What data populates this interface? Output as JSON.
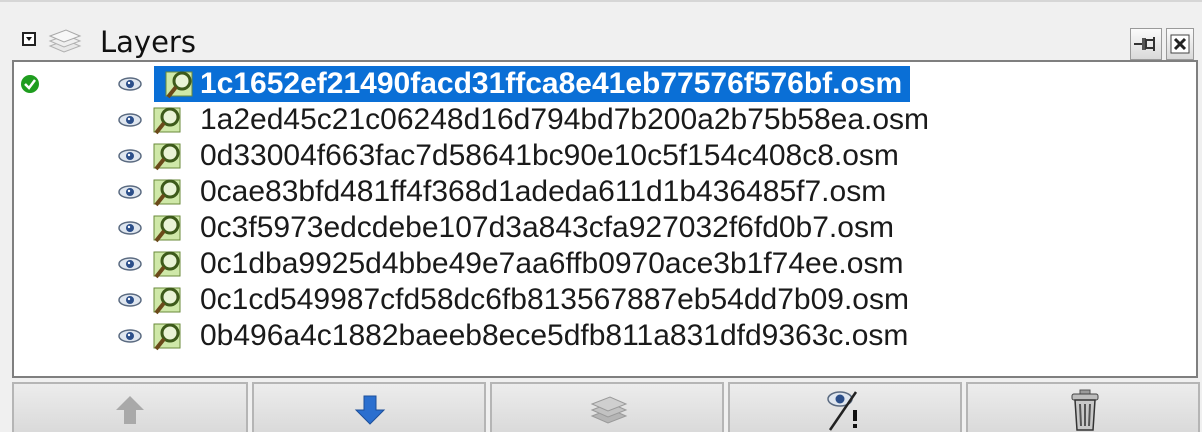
{
  "panel": {
    "title": "Layers"
  },
  "layers": [
    {
      "name": "1c1652ef21490facd31ffca8e41eb77576f576bf.osm",
      "selected": true,
      "active": true
    },
    {
      "name": "1a2ed45c21c06248d16d794bd7b200a2b75b58ea.osm",
      "selected": false,
      "active": false
    },
    {
      "name": "0d33004f663fac7d58641bc90e10c5f154c408c8.osm",
      "selected": false,
      "active": false
    },
    {
      "name": "0cae83bfd481ff4f368d1adeda611d1b436485f7.osm",
      "selected": false,
      "active": false
    },
    {
      "name": "0c3f5973edcdebe107d3a843cfa927032f6fd0b7.osm",
      "selected": false,
      "active": false
    },
    {
      "name": "0c1dba9925d4bbe49e7aa6ffb0970ace3b1f74ee.osm",
      "selected": false,
      "active": false
    },
    {
      "name": "0c1cd549987cfd58dc6fb813567887eb54dd7b09.osm",
      "selected": false,
      "active": false
    },
    {
      "name": "0b496a4c1882baeeb8ece5dfb811a831dfd9363c.osm",
      "selected": false,
      "active": false
    }
  ],
  "toolbar": {
    "buttons": [
      {
        "icon": "move-up-icon",
        "enabled": false
      },
      {
        "icon": "move-down-icon",
        "enabled": true
      },
      {
        "icon": "merge-layers-icon",
        "enabled": false
      },
      {
        "icon": "toggle-visibility-icon",
        "enabled": true
      },
      {
        "icon": "delete-icon",
        "enabled": true
      }
    ]
  },
  "colors": {
    "selection": "#0a6fd6",
    "active_check": "#1f9d1f",
    "move_down_arrow": "#2b6fcf"
  }
}
